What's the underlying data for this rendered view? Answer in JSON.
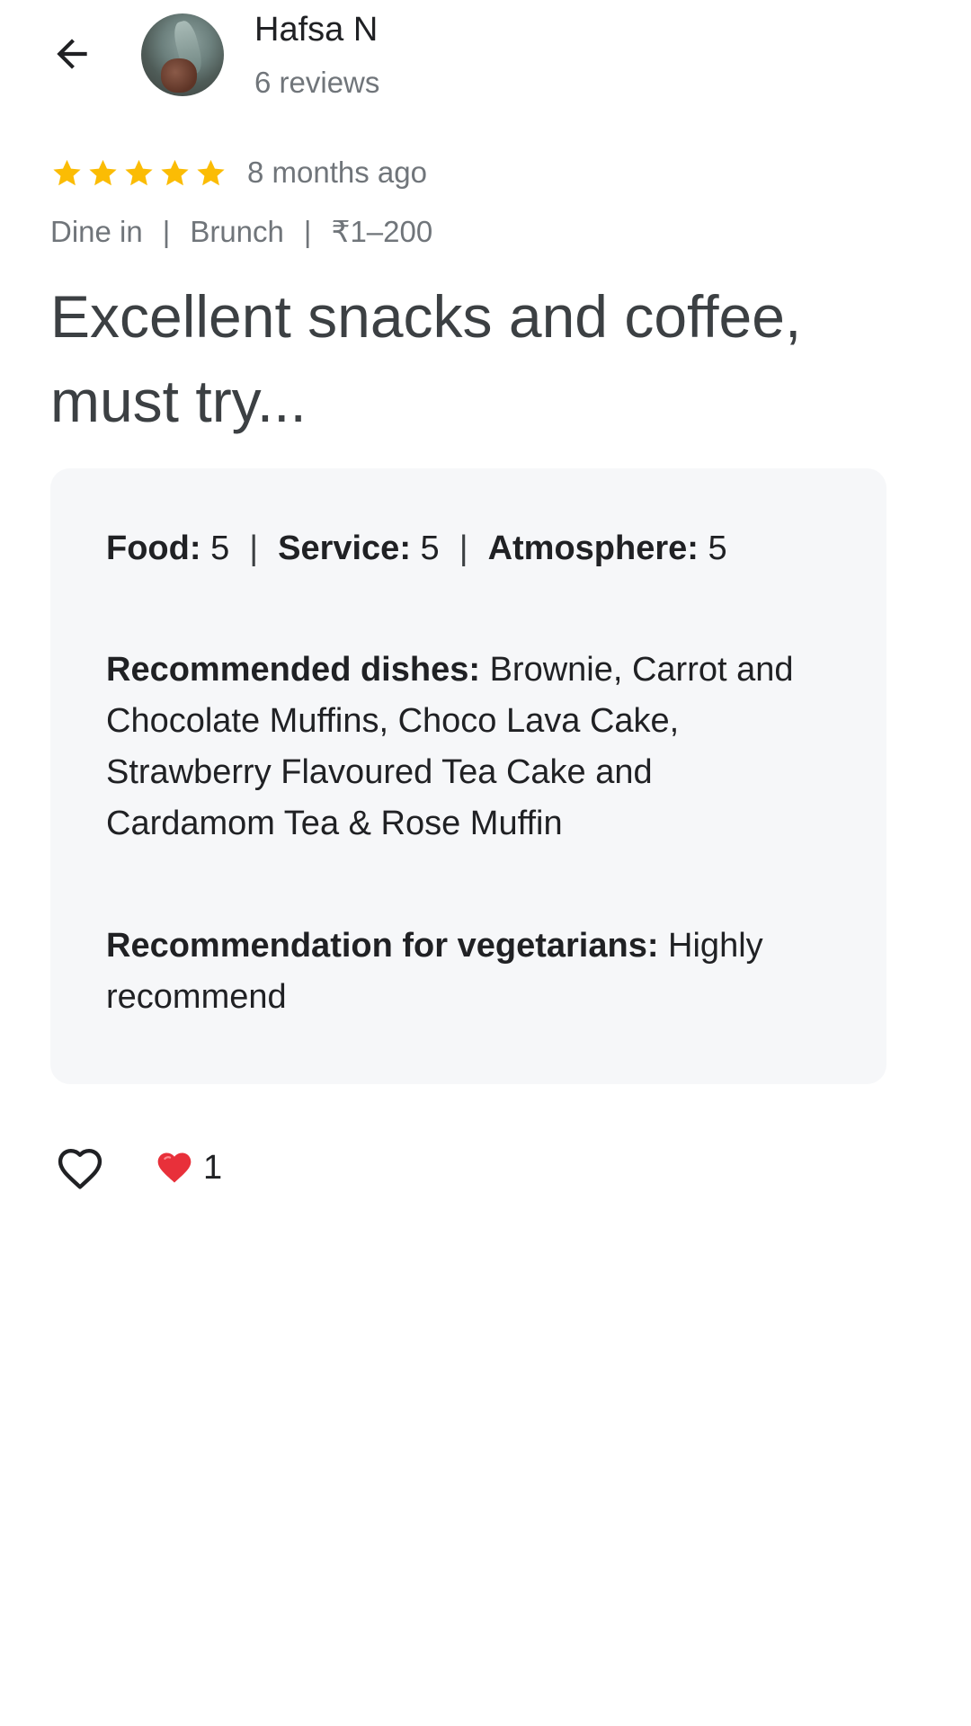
{
  "reviewer": {
    "name": "Hafsa N",
    "review_count": "6 reviews"
  },
  "review": {
    "rating": 5,
    "rating_max": 5,
    "time_ago": "8 months ago",
    "tags": [
      "Dine in",
      "Brunch",
      "₹1–200"
    ],
    "title": "Excellent snacks and coffee, must try..."
  },
  "details": {
    "scores": [
      {
        "label": "Food:",
        "value": "5"
      },
      {
        "label": "Service:",
        "value": "5"
      },
      {
        "label": "Atmosphere:",
        "value": "5"
      }
    ],
    "recommended_dishes": {
      "label": "Recommended dishes:",
      "value": "Brownie, Carrot and Chocolate Muffins, Choco Lava Cake, Strawberry Flavoured Tea Cake and Cardamom Tea & Rose Muffin"
    },
    "vegetarian": {
      "label": "Recommendation for vegetarians:",
      "value": "Highly recommend"
    }
  },
  "actions": {
    "reaction_count": "1"
  },
  "icons": {
    "back": "arrow-back-icon",
    "like": "heart-outline-icon",
    "reaction": "red-heart-icon",
    "star": "star-filled-icon"
  },
  "colors": {
    "star": "#fbbc04",
    "reaction_heart": "#e8303a",
    "card_bg": "#f6f7f9",
    "secondary_text": "#70757a"
  }
}
